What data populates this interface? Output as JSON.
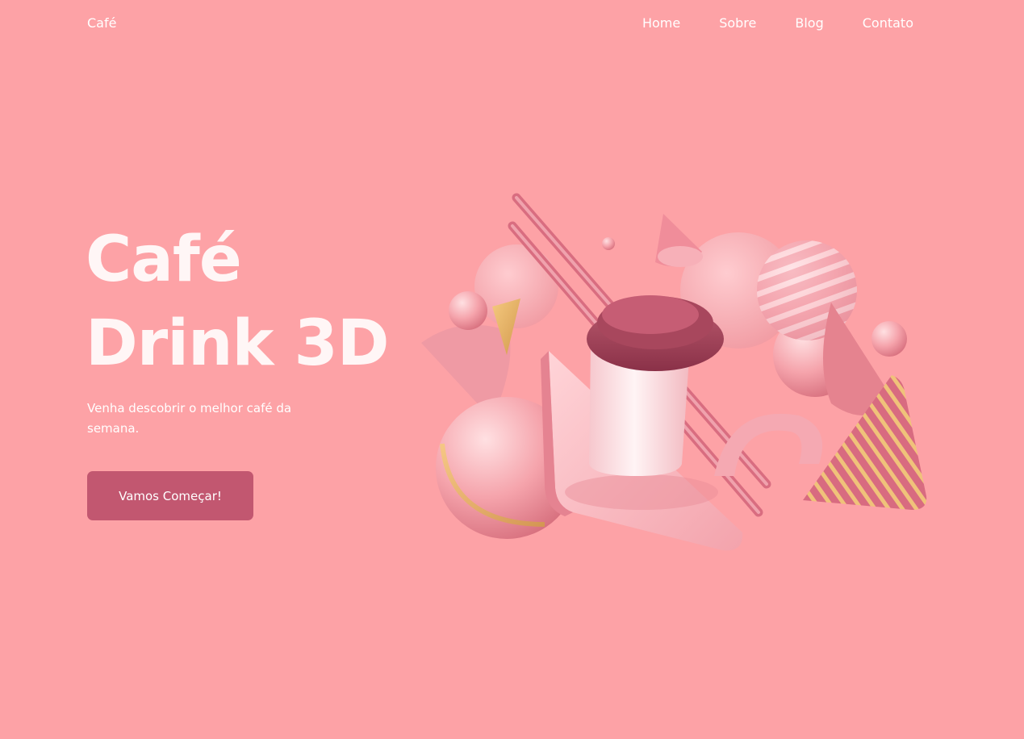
{
  "nav": {
    "brand": "Café",
    "links": [
      "Home",
      "Sobre",
      "Blog",
      "Contato"
    ]
  },
  "hero": {
    "title_line1": "Café",
    "title_line2": "Drink 3D",
    "subtitle": "Venha descobrir o melhor café da semana.",
    "cta_label": "Vamos Começar!"
  },
  "colors": {
    "background": "#fda2a6",
    "button": "#c25770",
    "text": "#ffffff"
  },
  "illustration": {
    "icon": "coffee-cup-3d-shapes-illustration"
  }
}
